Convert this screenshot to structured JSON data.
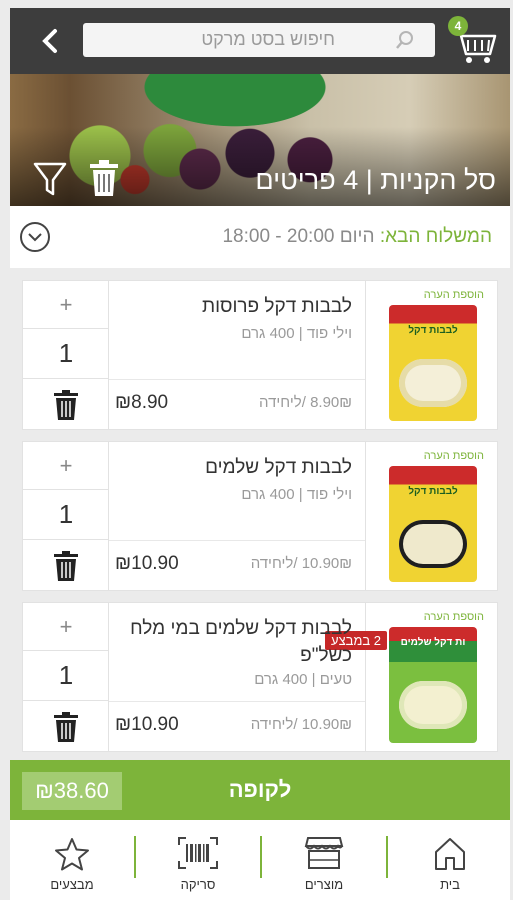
{
  "search": {
    "placeholder": "חיפוש בסט מרקט"
  },
  "header": {
    "cart_count": "4"
  },
  "hero": {
    "title": "סל הקניות | 4 פריטים"
  },
  "delivery": {
    "label": "המשלוח הבא:",
    "value": " היום 20:00 - 18:00"
  },
  "items": [
    {
      "add_note": "הוספת הערה",
      "name": "לבבות דקל פרוסות",
      "brand": "וילי פוד",
      "size": "400 גרם",
      "unit_price": "8.90₪ /ליחידה",
      "total": "₪8.90",
      "qty": "1",
      "pkg_label": "לבבות דקל",
      "promo": ""
    },
    {
      "add_note": "הוספת הערה",
      "name": "לבבות דקל שלמים",
      "brand": "וילי פוד",
      "size": "400 גרם",
      "unit_price": "10.90₪ /ליחידה",
      "total": "₪10.90",
      "qty": "1",
      "pkg_label": "לבבות דקל",
      "promo": ""
    },
    {
      "add_note": "הוספת הערה",
      "name": "לבבות דקל שלמים במי מלח כשל\"פ",
      "brand": "טעים",
      "size": "400 גרם",
      "unit_price": "10.90₪ /ליחידה",
      "total": "₪10.90",
      "qty": "1",
      "pkg_label": "ות דקל שלמים",
      "promo": "2 במבצע"
    }
  ],
  "checkout": {
    "label": "לקופה",
    "total": "₪38.60"
  },
  "nav": {
    "home": "בית",
    "products": "מוצרים",
    "scan": "סריקה",
    "deals": "מבצעים"
  },
  "colors": {
    "accent": "#7db43a",
    "topbar": "#3d3d3d",
    "promo": "#c62828"
  }
}
